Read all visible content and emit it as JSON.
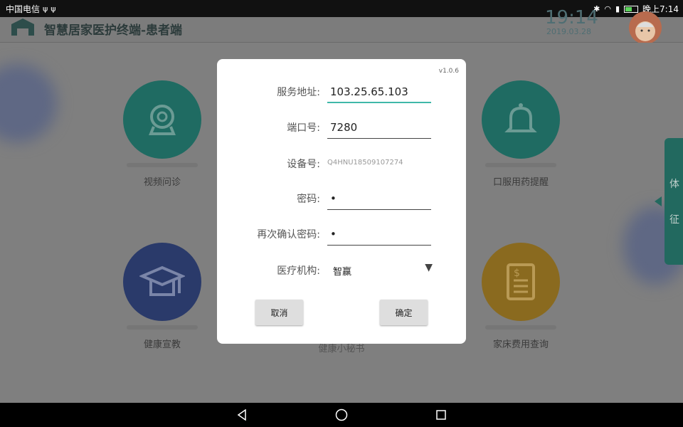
{
  "status_bar": {
    "carrier": "中国电信",
    "usb_icons": [
      "usb-icon",
      "usb-icon"
    ],
    "right_icons": [
      "bluetooth-icon",
      "wifi-icon",
      "signal-icon",
      "battery-icon"
    ],
    "time": "晚上7:14",
    "battery_level": 0.5
  },
  "header": {
    "title": "智慧居家医护终端-患者端",
    "clock": "19:14",
    "date": "2019.03.28"
  },
  "tiles": [
    {
      "label": "视频问诊",
      "icon": "webcam-icon",
      "color": "#1f6b62"
    },
    {
      "label": "口服用药提醒",
      "icon": "bell-icon",
      "color": "#1f6b62"
    },
    {
      "label": "健康宣教",
      "icon": "graduation-cap-icon",
      "color": "#2a3a6a"
    },
    {
      "label": "健康小秘书",
      "icon": "assistant-icon",
      "color": "#2a3a6a"
    },
    {
      "label": "家床费用查询",
      "icon": "bill-icon",
      "color": "#8a6a1f"
    }
  ],
  "side_tab": {
    "chars": [
      "体",
      "征"
    ]
  },
  "pager": {
    "progress": 0.5
  },
  "dialog": {
    "version": "v1.0.6",
    "fields": {
      "server_label": "服务地址:",
      "server_value": "103.25.65.103",
      "port_label": "端口号:",
      "port_value": "7280",
      "device_label": "设备号:",
      "device_value": "Q4HNU18509107274",
      "password_label": "密码:",
      "password_value": "•",
      "confirm_label": "再次确认密码:",
      "confirm_value": "•",
      "org_label": "医疗机构:",
      "org_value": "智赢"
    },
    "cancel_label": "取消",
    "ok_label": "确定"
  },
  "colors": {
    "accent": "#3fb8a9",
    "teal": "#1f6b62",
    "navy": "#2a3a6a",
    "gold": "#8a6a1f"
  }
}
